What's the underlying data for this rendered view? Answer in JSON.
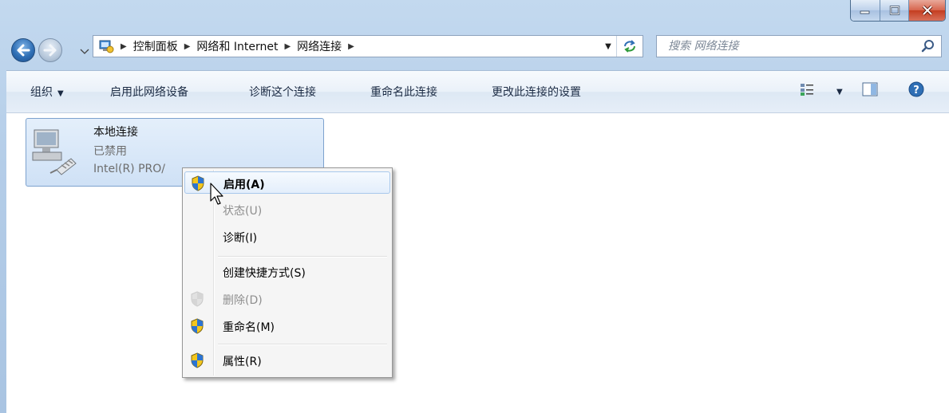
{
  "window": {
    "caption_buttons": [
      "minimize",
      "maximize",
      "close"
    ]
  },
  "address_bar": {
    "breadcrumbs": [
      "控制面板",
      "网络和 Internet",
      "网络连接"
    ],
    "search_placeholder": "搜索 网络连接"
  },
  "command_bar": {
    "organize": "组织",
    "enable_device": "启用此网络设备",
    "diagnose": "诊断这个连接",
    "rename": "重命名此连接",
    "change_settings": "更改此连接的设置"
  },
  "connection": {
    "name": "本地连接",
    "status": "已禁用",
    "device": "Intel(R) PRO/"
  },
  "context_menu": {
    "items": [
      {
        "label": "启用(A)",
        "icon": "uac-shield-icon",
        "bold": true,
        "highlighted": true,
        "disabled": false
      },
      {
        "label": "状态(U)",
        "icon": "",
        "bold": false,
        "highlighted": false,
        "disabled": true
      },
      {
        "label": "诊断(I)",
        "icon": "",
        "bold": false,
        "highlighted": false,
        "disabled": false
      },
      {
        "label": "创建快捷方式(S)",
        "icon": "",
        "bold": false,
        "highlighted": false,
        "disabled": false
      },
      {
        "label": "删除(D)",
        "icon": "uac-shield-icon",
        "bold": false,
        "highlighted": false,
        "disabled": true
      },
      {
        "label": "重命名(M)",
        "icon": "uac-shield-icon",
        "bold": false,
        "highlighted": false,
        "disabled": false
      },
      {
        "label": "属性(R)",
        "icon": "uac-shield-icon",
        "bold": false,
        "highlighted": false,
        "disabled": false
      }
    ]
  },
  "colors": {
    "accent": "#2f6fb5",
    "selection_fill": "#cfe1f6",
    "disabled_text": "#8e8e8e"
  }
}
